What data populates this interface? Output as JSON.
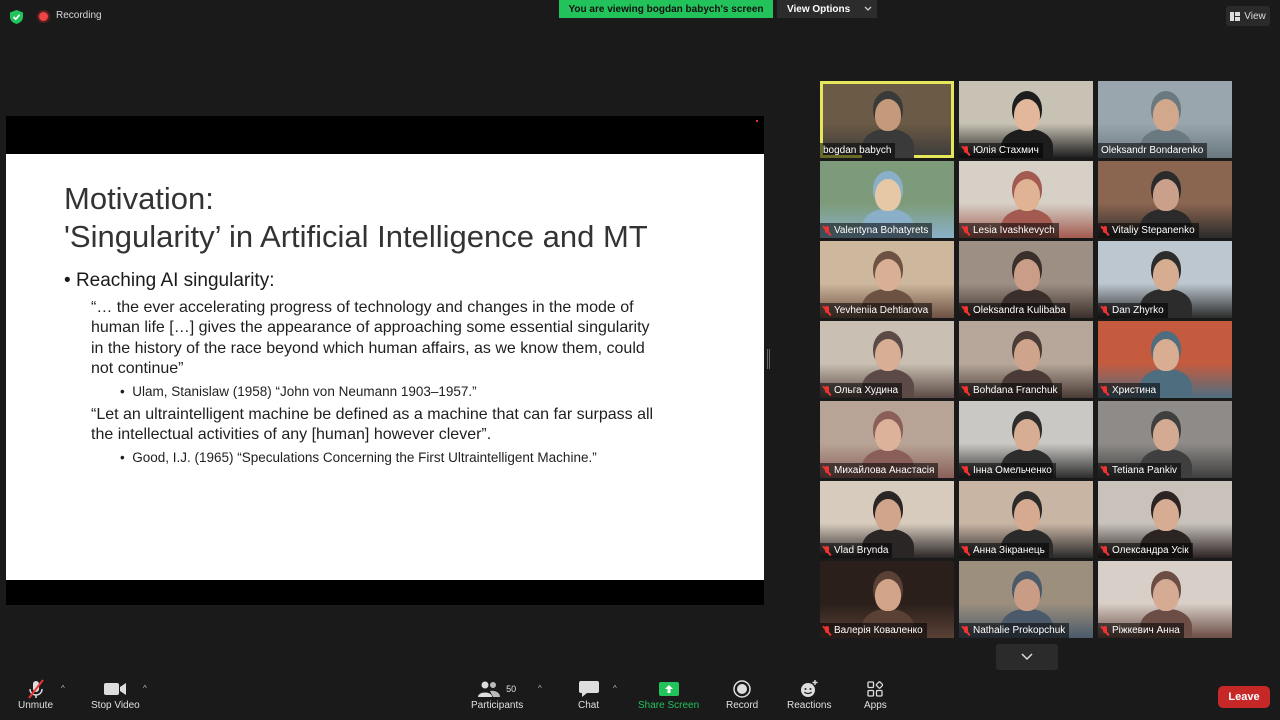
{
  "top_bar": {
    "recording_label": "Recording",
    "banner": "You are viewing bogdan babych's screen",
    "view_options_label": "View Options",
    "view_label": "View"
  },
  "slide": {
    "title_line1": "Motivation:",
    "title_line2": "'Singularity’ in Artificial Intelligence and MT",
    "bullet1": "Reaching AI singularity:",
    "quote1_l1": "“… the ever accelerating progress of technology and changes in the mode of",
    "quote1_l2": "human life […] gives the appearance of approaching some essential singularity",
    "quote1_l3": "in the history of the race beyond which human affairs, as we know them, could",
    "quote1_l4": "not continue”",
    "ref1": "Ulam, Stanislaw (1958) “John von Neumann 1903–1957.”",
    "quote2_l1": "“Let an ultraintelligent machine be defined as a machine that can far surpass all",
    "quote2_l2": "the intellectual activities of any [human] however clever”.",
    "ref2": "Good, I.J. (1965) “Speculations Concerning the First Ultraintelligent Machine.”"
  },
  "participants": [
    {
      "name": "bogdan babych",
      "muted": false
    },
    {
      "name": "Юлія Стахмич",
      "muted": true
    },
    {
      "name": "Oleksandr Bondarenko",
      "muted": false
    },
    {
      "name": "Valentyna Bohatyrets",
      "muted": true
    },
    {
      "name": "Lesia Ivashkevych",
      "muted": true
    },
    {
      "name": "Vitaliy Stepanenko",
      "muted": true
    },
    {
      "name": "Yevheniia Dehtiarova",
      "muted": true
    },
    {
      "name": "Oleksandra Kulibaba",
      "muted": true
    },
    {
      "name": "Dan Zhyrko",
      "muted": true
    },
    {
      "name": "Ольга Худина",
      "muted": true
    },
    {
      "name": "Bohdana Franchuk",
      "muted": true
    },
    {
      "name": "Христина",
      "muted": true
    },
    {
      "name": "Михайлова Анастасія",
      "muted": true
    },
    {
      "name": "Інна Омельченко",
      "muted": true
    },
    {
      "name": "Tetiana Pankiv",
      "muted": true
    },
    {
      "name": "Vlad Brynda",
      "muted": true
    },
    {
      "name": "Анна Зікранець",
      "muted": true
    },
    {
      "name": "Олександра Усік",
      "muted": true
    },
    {
      "name": "Валерія Коваленко",
      "muted": true
    },
    {
      "name": "Nathalie Prokopchuk",
      "muted": true
    },
    {
      "name": "Ріжкевич Анна",
      "muted": true
    }
  ],
  "toolbar": {
    "unmute": "Unmute",
    "stop_video": "Stop Video",
    "participants": "Participants",
    "participants_count": "50",
    "chat": "Chat",
    "share_screen": "Share Screen",
    "record": "Record",
    "reactions": "Reactions",
    "apps": "Apps",
    "leave": "Leave"
  },
  "colors": {
    "banner_green": "#23c35b",
    "leave_red": "#c62828",
    "active_speaker": "#e6e65a"
  }
}
